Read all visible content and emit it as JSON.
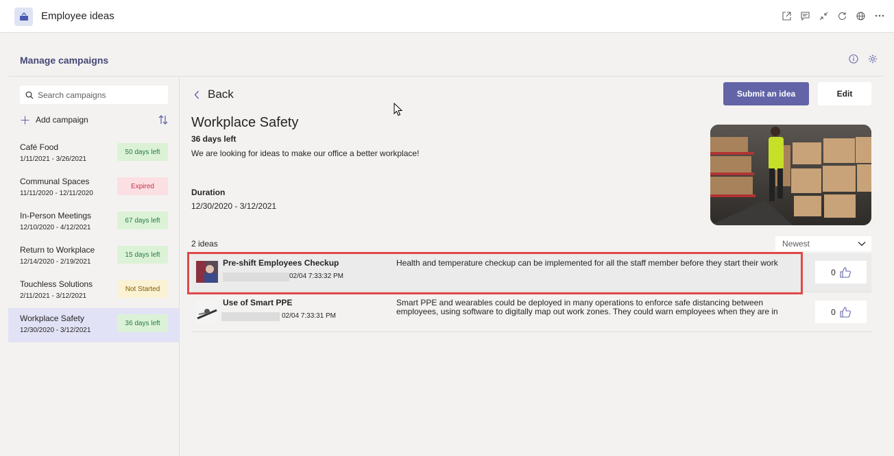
{
  "app": {
    "title": "Employee ideas",
    "icons": [
      "popout-icon",
      "chat-icon",
      "collapse-icon",
      "refresh-icon",
      "globe-icon",
      "more-icon"
    ]
  },
  "panel": {
    "title": "Manage campaigns"
  },
  "sidebar": {
    "search_placeholder": "Search campaigns",
    "add_label": "Add campaign",
    "campaigns": [
      {
        "name": "Café Food",
        "dates": "1/11/2021 - 3/26/2021",
        "status": "50 days left",
        "status_type": "green"
      },
      {
        "name": "Communal Spaces",
        "dates": "11/11/2020 - 12/11/2020",
        "status": "Expired",
        "status_type": "red"
      },
      {
        "name": "In-Person Meetings",
        "dates": "12/10/2020 - 4/12/2021",
        "status": "67 days left",
        "status_type": "green"
      },
      {
        "name": "Return to Workplace",
        "dates": "12/14/2020 - 2/19/2021",
        "status": "15 days left",
        "status_type": "green"
      },
      {
        "name": "Touchless Solutions",
        "dates": "2/11/2021 - 3/12/2021",
        "status": "Not Started",
        "status_type": "yellow"
      },
      {
        "name": "Workplace Safety",
        "dates": "12/30/2020 - 3/12/2021",
        "status": "36 days left",
        "status_type": "green"
      }
    ]
  },
  "main": {
    "back_label": "Back",
    "submit_label": "Submit an idea",
    "edit_label": "Edit",
    "campaign_title": "Workplace Safety",
    "days_left": "36 days left",
    "description": "We are looking for ideas to make our office a better workplace!",
    "duration_label": "Duration",
    "duration_value": "12/30/2020 - 3/12/2021",
    "ideas_count": "2 ideas",
    "sort_value": "Newest"
  },
  "ideas": [
    {
      "title": "Pre-shift Employees Checkup",
      "time": "02/04 7:33:32 PM",
      "description": "Health and temperature checkup can be implemented for all the staff member before they start their work",
      "likes": "0"
    },
    {
      "title": "Use of Smart PPE",
      "time": "02/04 7:33:31 PM",
      "description": "Smart PPE and wearables could be deployed in many operations to enforce safe distancing between employees, using software to digitally map out work zones. They could warn employees when they are in",
      "likes": "0"
    }
  ],
  "colors": {
    "brand": "#6264a7",
    "panel_title": "#464775",
    "highlight": "#e04848",
    "active_item": "#e2e2f6"
  }
}
